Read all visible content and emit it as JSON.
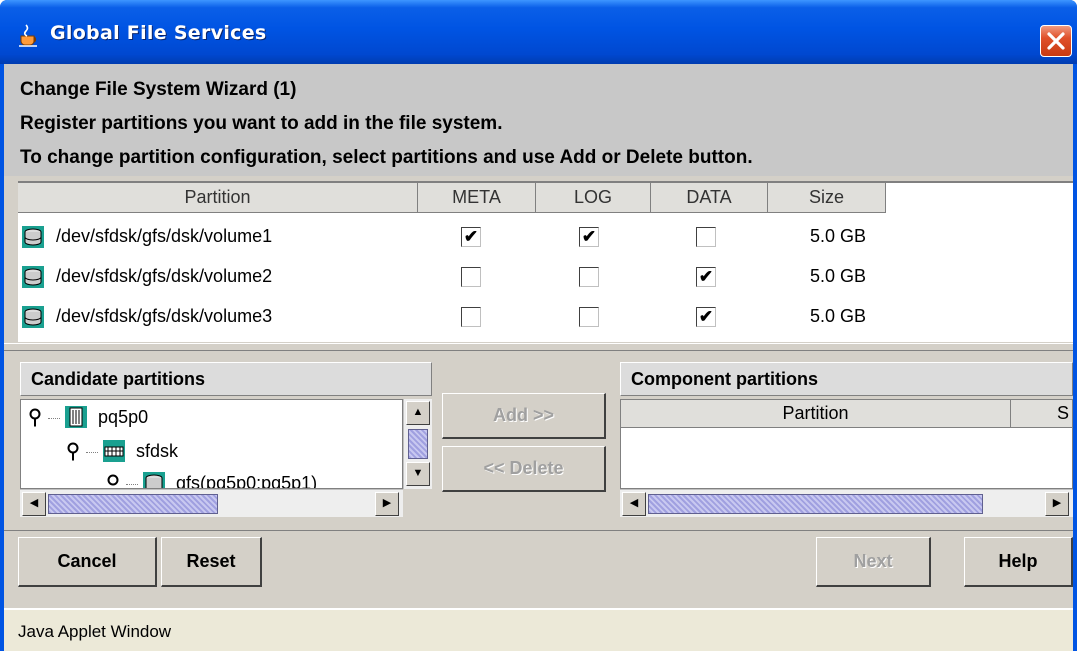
{
  "window": {
    "title": "Global File Services"
  },
  "header": {
    "title": "Change File System Wizard (1)",
    "line1": "Register partitions you want to add in the file system.",
    "line2": "To change partition configuration, select partitions and use Add or Delete button."
  },
  "table": {
    "columns": [
      "Partition",
      "META",
      "LOG",
      "DATA",
      "Size"
    ],
    "rows": [
      {
        "partition": "/dev/sfdsk/gfs/dsk/volume1",
        "meta": true,
        "log": true,
        "data": false,
        "size": "5.0 GB"
      },
      {
        "partition": "/dev/sfdsk/gfs/dsk/volume2",
        "meta": false,
        "log": false,
        "data": true,
        "size": "5.0 GB"
      },
      {
        "partition": "/dev/sfdsk/gfs/dsk/volume3",
        "meta": false,
        "log": false,
        "data": true,
        "size": "5.0 GB"
      }
    ]
  },
  "candidate": {
    "title": "Candidate partitions",
    "tree": [
      "pq5p0",
      "sfdsk",
      "gfs(pq5p0:pq5p1)"
    ]
  },
  "component": {
    "title": "Component partitions",
    "columns": [
      "Partition",
      "S"
    ]
  },
  "buttons": {
    "add": "Add >>",
    "delete": "<< Delete",
    "cancel": "Cancel",
    "reset": "Reset",
    "next": "Next",
    "help": "Help"
  },
  "status": {
    "text": "Java Applet Window"
  },
  "icons": {
    "title": "java-cup-icon",
    "close": "close-icon",
    "disk": "disk-icon",
    "node": "server-icon",
    "class": "disk-class-icon"
  },
  "colors": {
    "titlebar": "#0054e3",
    "close": "#e0502a",
    "diskIcon": "#1aa090",
    "client": "#d4d0c8"
  }
}
